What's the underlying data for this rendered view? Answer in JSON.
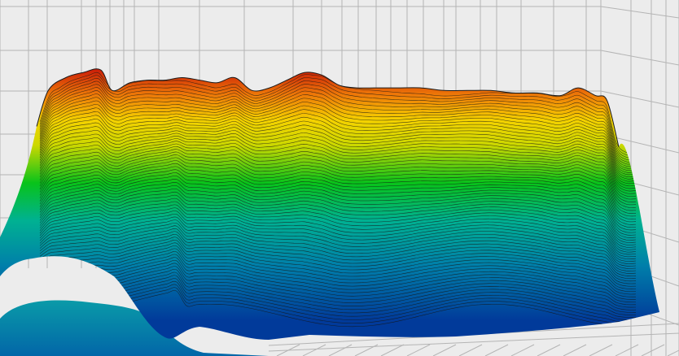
{
  "chart_data": {
    "type": "surface",
    "title": "",
    "xlabel": "",
    "ylabel": "",
    "zlabel": "",
    "grid": true,
    "colormap": "jet",
    "tick_labels_visible": false,
    "colormap_stops": [
      {
        "value": 0.0,
        "color": "#013a9a"
      },
      {
        "value": 0.22,
        "color": "#007faa"
      },
      {
        "value": 0.4,
        "color": "#00b192"
      },
      {
        "value": 0.55,
        "color": "#08c31a"
      },
      {
        "value": 0.7,
        "color": "#ccd800"
      },
      {
        "value": 0.8,
        "color": "#f5d200"
      },
      {
        "value": 0.9,
        "color": "#ee7a08"
      },
      {
        "value": 1.0,
        "color": "#cc2008"
      }
    ],
    "ridge_profile": {
      "x": [
        0,
        0.02,
        0.05,
        0.08,
        0.11,
        0.13,
        0.16,
        0.19,
        0.22,
        0.25,
        0.28,
        0.31,
        0.34,
        0.37,
        0.4,
        0.43,
        0.46,
        0.49,
        0.52,
        0.55,
        0.58,
        0.62,
        0.66,
        0.7,
        0.74,
        0.78,
        0.82,
        0.86,
        0.9,
        0.93,
        0.96,
        0.98,
        1.0
      ],
      "z": [
        0.78,
        0.92,
        0.97,
        0.99,
        1.0,
        0.92,
        0.95,
        0.96,
        0.96,
        0.97,
        0.96,
        0.95,
        0.97,
        0.92,
        0.93,
        0.96,
        0.99,
        0.98,
        0.94,
        0.93,
        0.93,
        0.93,
        0.93,
        0.92,
        0.92,
        0.92,
        0.91,
        0.91,
        0.9,
        0.93,
        0.9,
        0.88,
        0.7
      ]
    },
    "contour_levels": 72
  }
}
